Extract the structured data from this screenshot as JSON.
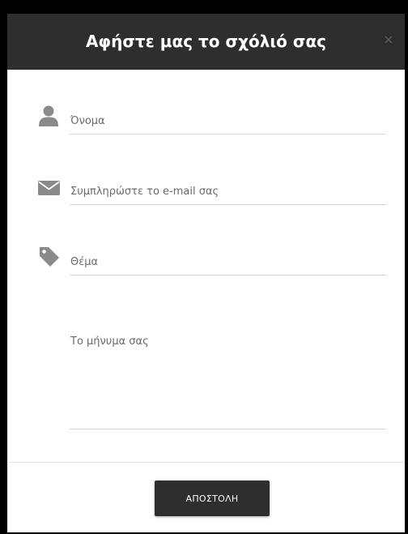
{
  "modal": {
    "title": "Αφήστε μας το σχόλιό σας",
    "close_label": "×"
  },
  "form": {
    "name_placeholder": "Όνομα",
    "email_placeholder": "Συμπληρώστε το e-mail σας",
    "subject_placeholder": "Θέμα",
    "message_placeholder": "Το μήνυμα σας",
    "submit_label": "ΑΠΟΣΤΟΛΗ"
  },
  "icons": {
    "name": "user-icon",
    "email": "envelope-icon",
    "subject": "tag-icon"
  },
  "colors": {
    "header_bg": "#2e2e2e",
    "icon": "#8a8a8a",
    "button_bg": "#2e2e2e"
  }
}
